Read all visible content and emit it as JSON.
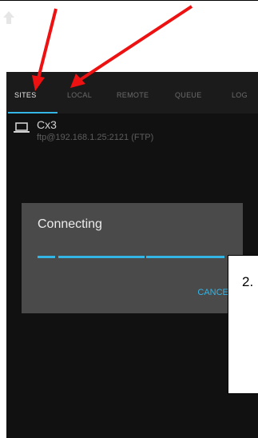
{
  "colors": {
    "accent": "#33b5e5",
    "annotation_arrow": "#ee1111",
    "background": "#111111"
  },
  "tabs": [
    {
      "label": "SITES",
      "active": true
    },
    {
      "label": "LOCAL",
      "active": false
    },
    {
      "label": "REMOTE",
      "active": false
    },
    {
      "label": "QUEUE",
      "active": false
    },
    {
      "label": "LOG",
      "active": false
    }
  ],
  "sites": [
    {
      "name": "Cx3",
      "address": "ftp@192.168.1.25:2121 (FTP)",
      "icon": "laptop-icon"
    }
  ],
  "dialog": {
    "title": "Connecting",
    "cancel_label": "CANCEL"
  },
  "callout": {
    "label": "2."
  }
}
